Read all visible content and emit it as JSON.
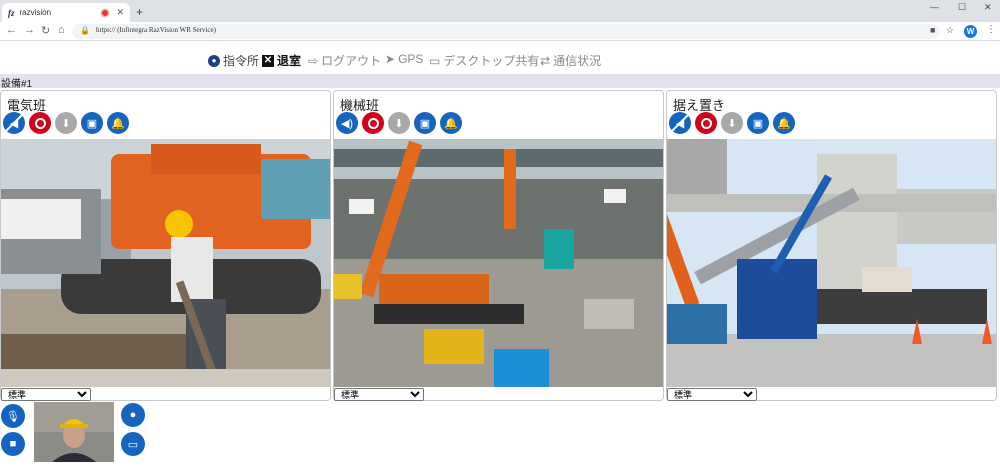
{
  "browser": {
    "tab_title": "razvision",
    "tab_favicon_text": "fz",
    "new_tab": "+",
    "close_tab": "✕",
    "url": "https:// (Infintegra RazVision WR Service)",
    "profile_initial": "W"
  },
  "nav": {
    "items": [
      {
        "label": "指令所",
        "icon": "user-circle-icon"
      },
      {
        "label": "退室",
        "icon": "close-box-icon"
      },
      {
        "label": "ログアウト",
        "icon": "logout-icon"
      },
      {
        "label": "GPS",
        "icon": "location-arrow-icon"
      },
      {
        "label": "デスクトップ共有",
        "icon": "desktop-icon"
      },
      {
        "label": "通信状況",
        "icon": "exchange-icon"
      }
    ]
  },
  "facility_label": "設備#1",
  "panels": [
    {
      "name": "電気班",
      "audio_muted": true,
      "quality": "標準"
    },
    {
      "name": "機械班",
      "audio_muted": false,
      "quality": "標準"
    },
    {
      "name": "据え置き",
      "audio_muted": true,
      "quality": "標準"
    }
  ],
  "colors": {
    "accent_blue": "#1565c0",
    "record_red": "#d0021b",
    "disabled_grey": "#a8a8a8",
    "stripe": "#e4e2f1"
  }
}
